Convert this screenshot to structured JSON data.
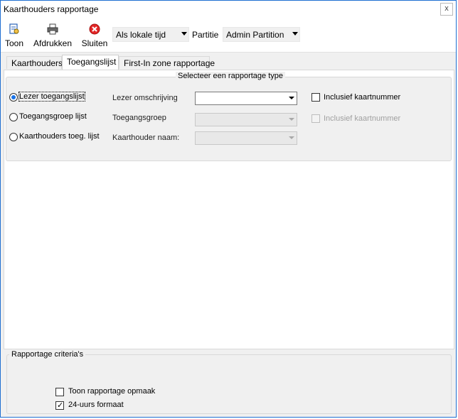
{
  "window": {
    "title": "Kaarthouders rapportage",
    "close_label": "x"
  },
  "toolbar": {
    "buttons": [
      {
        "label": "Toon",
        "icon": "report-view-icon"
      },
      {
        "label": "Afdrukken",
        "icon": "printer-icon"
      },
      {
        "label": "Sluiten",
        "icon": "close-circle-icon"
      }
    ],
    "time_mode": "Als lokale tijd",
    "partition_label": "Partitie",
    "partition_value": "Admin Partition"
  },
  "tabs": [
    {
      "label": "Kaarthouders",
      "active": false
    },
    {
      "label": "Toegangslijst",
      "active": true
    },
    {
      "label": "First-In zone rapportage",
      "active": false
    }
  ],
  "report_type": {
    "title": "Selecteer een rapportage type",
    "options": [
      {
        "label": "Lezer toegangslijst",
        "checked": true
      },
      {
        "label": "Toegangsgroep lijst",
        "checked": false
      },
      {
        "label": "Kaarthouders toeg. lijst",
        "checked": false
      }
    ],
    "fields": [
      {
        "label": "Lezer omschrijving",
        "value": "",
        "enabled": true
      },
      {
        "label": "Toegangsgroep",
        "value": "",
        "enabled": false
      },
      {
        "label": "Kaarthouder naam:",
        "value": "",
        "enabled": false
      }
    ],
    "checkboxes": [
      {
        "label": "Inclusief kaartnummer",
        "checked": false,
        "enabled": true
      },
      {
        "label": "Inclusief kaartnummer",
        "checked": false,
        "enabled": false
      }
    ]
  },
  "criteria": {
    "title": "Rapportage criteria's",
    "options": [
      {
        "label": "Toon rapportage opmaak",
        "checked": false
      },
      {
        "label": "24-uurs formaat",
        "checked": true
      }
    ]
  },
  "colors": {
    "window_border": "#1f6fd1",
    "radio_dot": "#1a73e8",
    "close_icon": "#e32727"
  }
}
